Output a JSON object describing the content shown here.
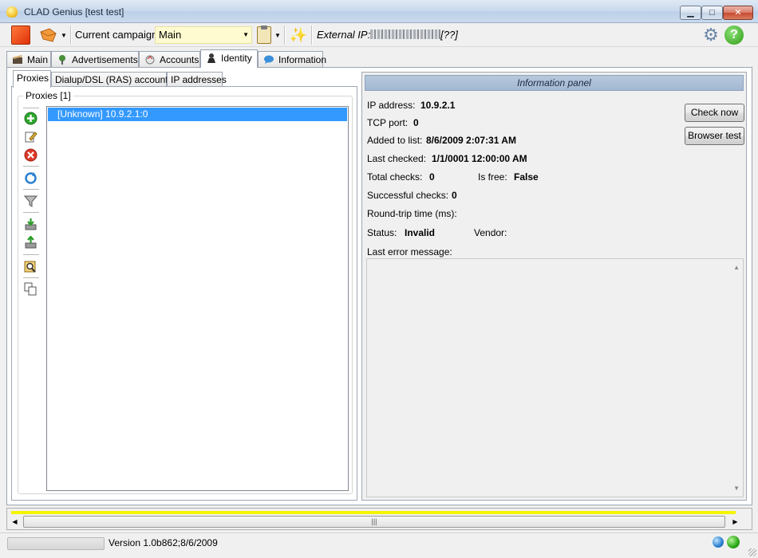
{
  "window": {
    "title": "CLAD Genius [test test]"
  },
  "toolbar": {
    "campaign_label": "Current campaign",
    "campaign_value": "Main",
    "external_ip_label": "External IP:",
    "external_ip_suffix": "[??]"
  },
  "main_tabs": [
    {
      "label": "Main",
      "active": false
    },
    {
      "label": "Advertisements",
      "active": false
    },
    {
      "label": "Accounts",
      "active": false
    },
    {
      "label": "Identity",
      "active": true
    },
    {
      "label": "Information",
      "active": false
    }
  ],
  "inner_tabs": [
    {
      "label": "Proxies",
      "active": true
    },
    {
      "label": "Dialup/DSL (RAS) accounts",
      "active": false
    },
    {
      "label": "IP addresses",
      "active": false
    }
  ],
  "proxies": {
    "group_label": "Proxies [1]",
    "items": [
      "[Unknown] 10.9.2.1:0"
    ]
  },
  "info_panel": {
    "header": "Information panel",
    "ip_label": "IP address:",
    "ip_value": "10.9.2.1",
    "tcp_label": "TCP port:",
    "tcp_value": "0",
    "added_label": "Added to list:",
    "added_value": "8/6/2009 2:07:31 AM",
    "checked_label": "Last checked:",
    "checked_value": "1/1/0001 12:00:00 AM",
    "total_label": "Total checks:",
    "total_value": "0",
    "free_label": "Is free:",
    "free_value": "False",
    "success_label": "Successful checks:",
    "success_value": "0",
    "rtt_label": "Round-trip time (ms):",
    "status_label": "Status:",
    "status_value": "Invalid",
    "vendor_label": "Vendor:",
    "error_label": "Last error message:",
    "check_now": "Check now",
    "browser_test": "Browser test"
  },
  "statusbar": {
    "version": "Version 1.0b862;8/6/2009"
  },
  "colors": {
    "selection": "#3399ff",
    "progress_strip": "#f4f400",
    "info_header": "#a9bdd6"
  }
}
